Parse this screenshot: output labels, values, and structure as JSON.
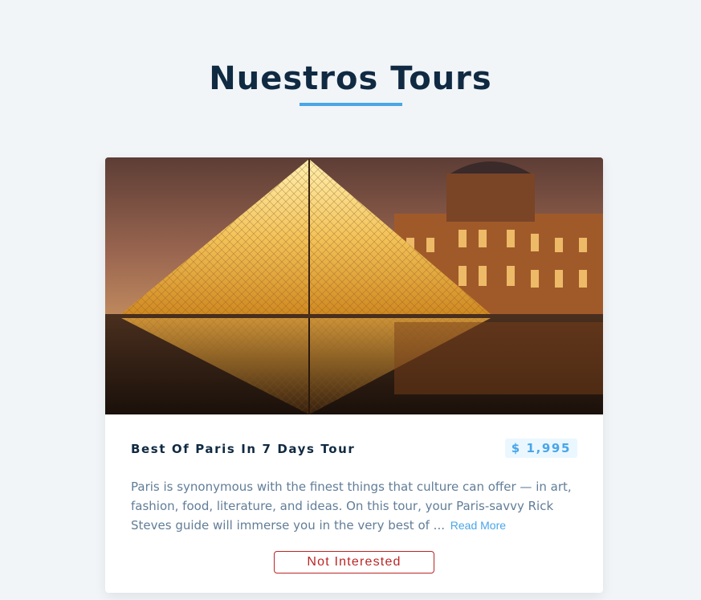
{
  "header": {
    "title": "Nuestros Tours"
  },
  "tour": {
    "image_alt": "Louvre pyramid at night",
    "name": "Best Of Paris In 7 Days Tour",
    "price": "$ 1,995",
    "info": "Paris is synonymous with the finest things that culture can offer — in art, fashion, food, literature, and ideas. On this tour, your Paris-savvy Rick Steves guide will immerse you in the very best of ...",
    "read_more_label": "Read More",
    "not_interested_label": "Not Interested"
  },
  "colors": {
    "background": "#f1f5f8",
    "title": "#102a42",
    "accent": "#49a6e9",
    "danger": "#bb2525",
    "text": "#617d98"
  }
}
